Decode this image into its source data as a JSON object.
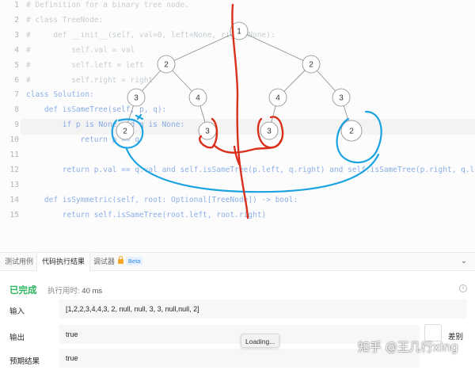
{
  "editor": {
    "lines": [
      {
        "n": "1",
        "text": "# Definition for a binary tree node.",
        "kind": "comment"
      },
      {
        "n": "2",
        "text": "# class TreeNode:",
        "kind": "comment"
      },
      {
        "n": "3",
        "text": "#     def __init__(self, val=0, left=None, right=None):",
        "kind": "comment"
      },
      {
        "n": "4",
        "text": "#         self.val = val",
        "kind": "comment"
      },
      {
        "n": "5",
        "text": "#         self.left = left",
        "kind": "comment"
      },
      {
        "n": "6",
        "text": "#         self.right = right",
        "kind": "comment"
      },
      {
        "n": "7",
        "text": "class Solution:",
        "kind": "keyword"
      },
      {
        "n": "8",
        "text": "    def isSameTree(self, p, q):",
        "kind": "keyword"
      },
      {
        "n": "9",
        "text": "        if p is None and q is None:",
        "kind": "keyword"
      },
      {
        "n": "10",
        "text": "            return p == q",
        "kind": "keyword"
      },
      {
        "n": "11",
        "text": "",
        "kind": "plain"
      },
      {
        "n": "12",
        "text": "        return p.val == q.val and self.isSameTree(p.left, q.right) and self.isSameTree(p.right, q.left)",
        "kind": "keyword"
      },
      {
        "n": "13",
        "text": "",
        "kind": "plain"
      },
      {
        "n": "14",
        "text": "    def isSymmetric(self, root: Optional[TreeNode]) -> bool:",
        "kind": "keyword"
      },
      {
        "n": "15",
        "text": "        return self.isSameTree(root.left, root.right)",
        "kind": "keyword"
      }
    ]
  },
  "tree": {
    "nodes": [
      "1",
      "2",
      "2",
      "3",
      "4",
      "4",
      "3",
      "2",
      "3",
      "3",
      "2"
    ]
  },
  "tabs": {
    "testcase": "测试用例",
    "result": "代码执行结果",
    "debugger": "调试器",
    "beta": "Beta",
    "collapse_icon": "chevron-down-icon"
  },
  "result": {
    "status": "已完成",
    "runtime_label": "执行用时:",
    "runtime_value": "40 ms",
    "input_label": "输入",
    "input_value": "[1,2,2,3,4,4,3, 2, null, null, 3, 3, null,null, 2]",
    "output_label": "输出",
    "output_value": "true",
    "expected_label": "预期结果",
    "expected_value": "true",
    "diff_label": "差别",
    "loading": "Loading...",
    "watermark": "知乎 @王几行xing"
  },
  "colors": {
    "success": "#2db55d",
    "red_annotation": "#d9301c",
    "blue_annotation": "#1aa3e0"
  }
}
